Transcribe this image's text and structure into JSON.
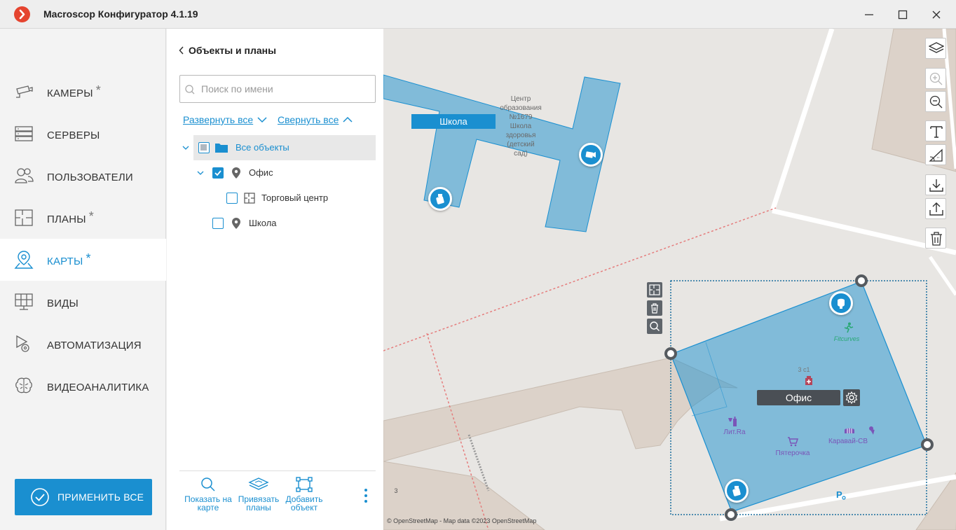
{
  "window": {
    "title": "Macroscop Конфигуратор 4.1.19",
    "icons": [
      "app-logo-icon",
      "minimize-icon",
      "maximize-icon",
      "close-icon"
    ]
  },
  "sidebar": {
    "items": [
      {
        "label": "КАМЕРЫ",
        "star": "*",
        "icon": "camera-icon"
      },
      {
        "label": "СЕРВЕРЫ",
        "star": "",
        "icon": "server-icon"
      },
      {
        "label": "ПОЛЬЗОВАТЕЛИ",
        "star": "",
        "icon": "users-icon"
      },
      {
        "label": "ПЛАНЫ",
        "star": "*",
        "icon": "plan-icon"
      },
      {
        "label": "КАРТЫ",
        "star": "*",
        "icon": "map-pin-icon",
        "active": true
      },
      {
        "label": "ВИДЫ",
        "star": "",
        "icon": "monitor-icon"
      },
      {
        "label": "АВТОМАТИЗАЦИЯ",
        "star": "",
        "icon": "automation-icon"
      },
      {
        "label": "ВИДЕОАНАЛИТИКА",
        "star": "",
        "icon": "brain-icon"
      }
    ],
    "apply_label": "ПРИМЕНИТЬ ВСЕ"
  },
  "panel": {
    "title": "Объекты и планы",
    "search_placeholder": "Поиск по имени",
    "expand_all": "Развернуть все",
    "collapse_all": "Свернуть все",
    "tree": [
      {
        "label": "Все объекты",
        "state": "indeterminate",
        "icon": "folder-icon"
      },
      {
        "label": "Офис",
        "state": "checked",
        "icon": "location-icon"
      },
      {
        "label": "Торговый центр",
        "state": "unchecked",
        "icon": "floorplan-icon"
      },
      {
        "label": "Школа",
        "state": "unchecked",
        "icon": "location-icon"
      }
    ],
    "tools": {
      "show_on_map": "Показать на карте",
      "bind_plans": "Привязать планы",
      "add_object": "Добавить объект"
    }
  },
  "map": {
    "school_label": "Школа",
    "office_label": "Офис",
    "building_label": [
      "Центр",
      "образования",
      "№1679",
      "Школа",
      "здоровья",
      "(детский",
      "сад)"
    ],
    "poi": {
      "fitcurves": "Fitcurves",
      "house_no": "3 с1",
      "litra": "Лит.Ra",
      "pyaterochka": "Пятерочка",
      "karavai": "Каравай-СВ",
      "number_3": "3"
    },
    "attribution": "© OpenStreetMap - Map data ©2023 OpenStreetMap",
    "toolbar": [
      "layers-icon",
      "zoom-in-icon",
      "zoom-out-icon",
      "text-icon",
      "measure-icon",
      "download-icon",
      "share-icon",
      "trash-icon"
    ],
    "accent": "#1a8fd0"
  }
}
